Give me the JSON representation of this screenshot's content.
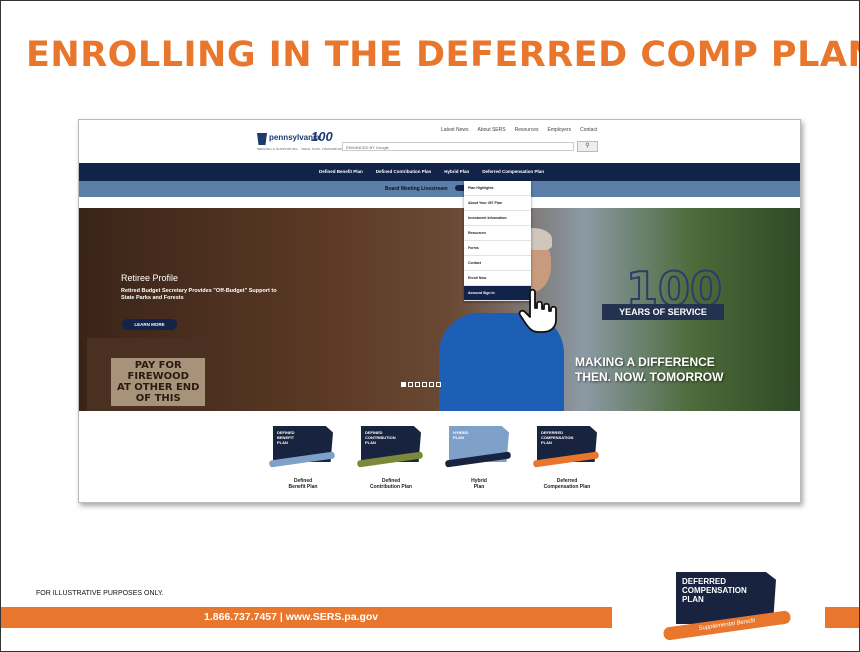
{
  "slide": {
    "title": "ENROLLING IN THE DEFERRED COMP PLAN",
    "footnote": "FOR ILLUSTRATIVE PURPOSES ONLY.",
    "contact": "1.866.737.7457 | www.SERS.pa.gov",
    "accent_color": "#e8762c",
    "logo": {
      "text": "DEFERRED\nCOMPENSATION\nPLAN",
      "swoosh": "Supplemental Benefit"
    }
  },
  "site": {
    "logo_word": "pennsylvania",
    "logo_hundred": "100",
    "logo_tag": "SERVING & SUPPORTING · THEN. NOW. TOMORROW",
    "top_links": [
      "Latest News",
      "About SERS",
      "Resources",
      "Employers",
      "Contact"
    ],
    "search": {
      "placeholder": "ENHANCED BY Google",
      "button_icon": "search-icon"
    },
    "nav": [
      "Defined Benefit Plan",
      "Defined Contribution Plan",
      "Hybrid Plan",
      "Deferred Compensation Plan"
    ],
    "subnav": "Board Meeting Livestream",
    "dropdown": [
      "Plan Highlights",
      "About Your 457 Plan",
      "Investment Information",
      "Resources",
      "Forms",
      "Contact",
      "Enroll Now",
      "Account Sign In"
    ],
    "hero": {
      "heading": "Retiree Profile",
      "text": "Retired Budget Secretary Provides \"Off-Budget\" Support to State Parks and Forests",
      "button": "LEARN MORE",
      "sign": "PAY FOR\nFIREWOOD\nAT OTHER END\nOF THIS",
      "years_number": "100",
      "years_ribbon": "YEARS OF SERVICE",
      "tagline": "MAKING A DIFFERENCE\nTHEN. NOW. TOMORROW"
    },
    "plans": [
      {
        "badge": "DEFINED\nBENEFIT\nPLAN",
        "label": "Defined\nBenefit Plan",
        "color": "#17233f",
        "swoosh": "#7fa0c8"
      },
      {
        "badge": "DEFINED\nCONTRIBUTION\nPLAN",
        "label": "Defined\nContribution Plan",
        "color": "#17233f",
        "swoosh": "#7a8a3a"
      },
      {
        "badge": "HYBRID\nPLAN",
        "label": "Hybrid\nPlan",
        "color": "#7fa0c8",
        "swoosh": "#17233f"
      },
      {
        "badge": "DEFERRED\nCOMPENSATION\nPLAN",
        "label": "Deferred\nCompensation Plan",
        "color": "#17233f",
        "swoosh": "#e8762c"
      }
    ]
  }
}
